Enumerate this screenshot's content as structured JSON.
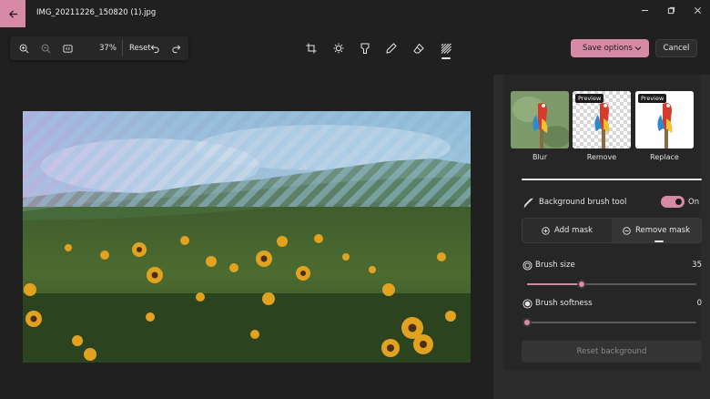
{
  "window": {
    "title": "IMG_20211226_150820 (1).jpg",
    "back_icon": "arrow-left-icon",
    "accent_color": "#d78aa6"
  },
  "zoom_toolbar": {
    "zoom_percent": "37%",
    "reset_label": "Reset"
  },
  "edit_tools": [
    "crop-icon",
    "adjust-brightness-icon",
    "filter-icon",
    "markup-pen-icon",
    "erase-icon",
    "background-icon"
  ],
  "actions": {
    "save_label": "Save options",
    "cancel_label": "Cancel"
  },
  "background_modes": [
    {
      "label": "Blur",
      "preview": ""
    },
    {
      "label": "Remove",
      "preview": "Preview"
    },
    {
      "label": "Replace",
      "preview": "Preview"
    }
  ],
  "brush_tool": {
    "label": "Background brush tool",
    "state": "On"
  },
  "mask": {
    "add_label": "Add mask",
    "remove_label": "Remove mask"
  },
  "brush_size": {
    "label": "Brush size",
    "value": "35",
    "fraction": 0.32
  },
  "brush_softness": {
    "label": "Brush softness",
    "value": "0",
    "fraction": 0.0
  },
  "reset_background_label": "Reset background"
}
